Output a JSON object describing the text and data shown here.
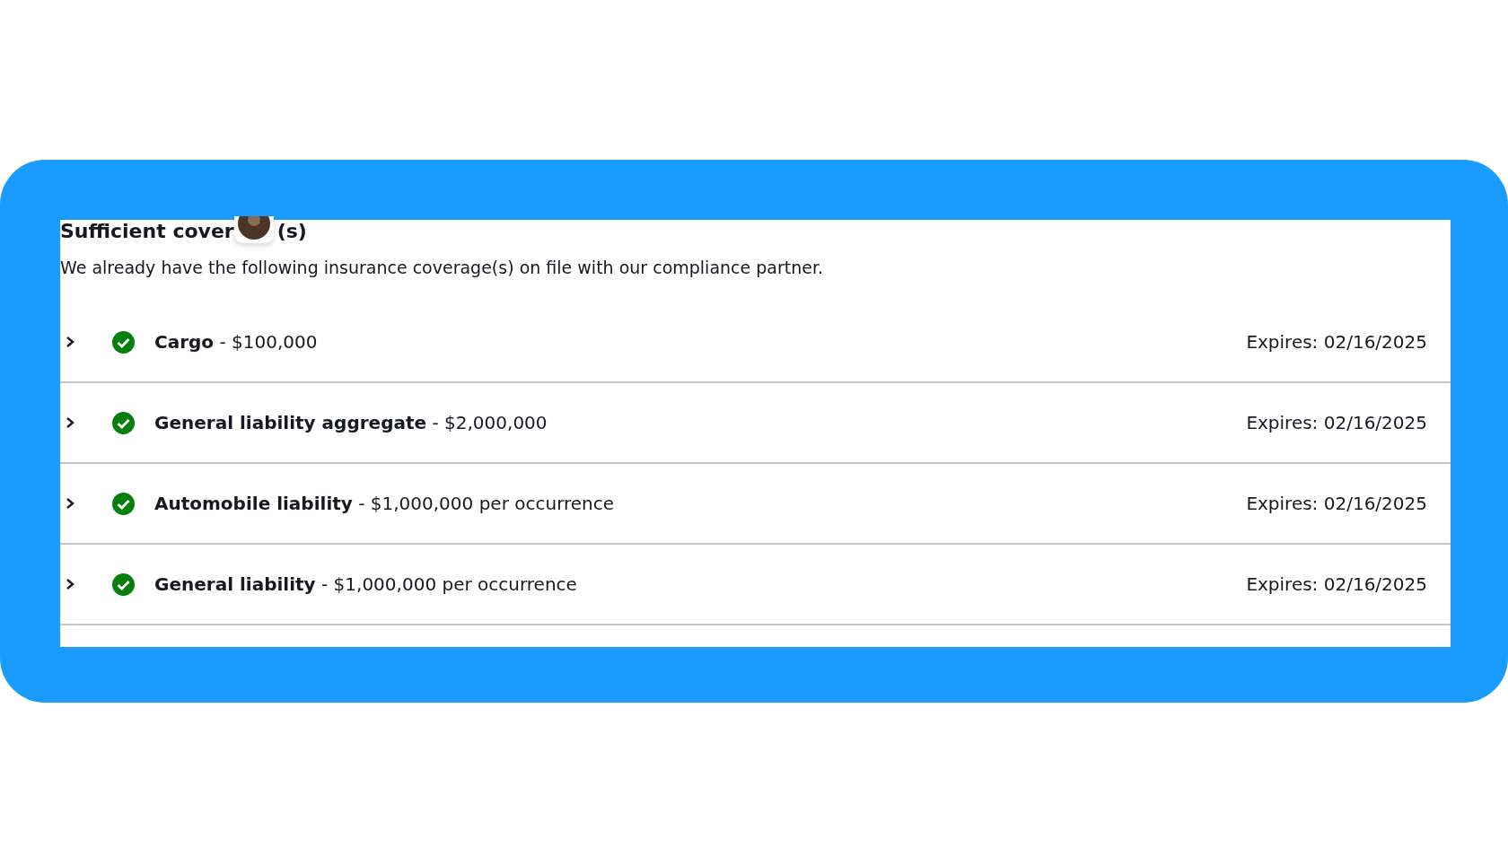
{
  "heading": {
    "text_before": "Sufficient cover",
    "text_after": "(s)"
  },
  "description": "We already have the following insurance coverage(s) on file with our compliance partner.",
  "coverages": [
    {
      "label": "**Cargo** - $100,000",
      "expires": "Expires: 02/16/2025",
      "expanded": false
    },
    {
      "label": "**General liability aggregate** - $2,000,000",
      "expires": "Expires: 02/16/2025",
      "expanded": false
    },
    {
      "label": "**Automobile liability** - $1,000,000 per occurrence",
      "expires": "Expires: 02/16/2025",
      "expanded": false
    },
    {
      "label": "**General liability** - $1,000,000 per occurrence",
      "expires": "Expires: 02/16/2025",
      "expanded": false
    }
  ]
}
